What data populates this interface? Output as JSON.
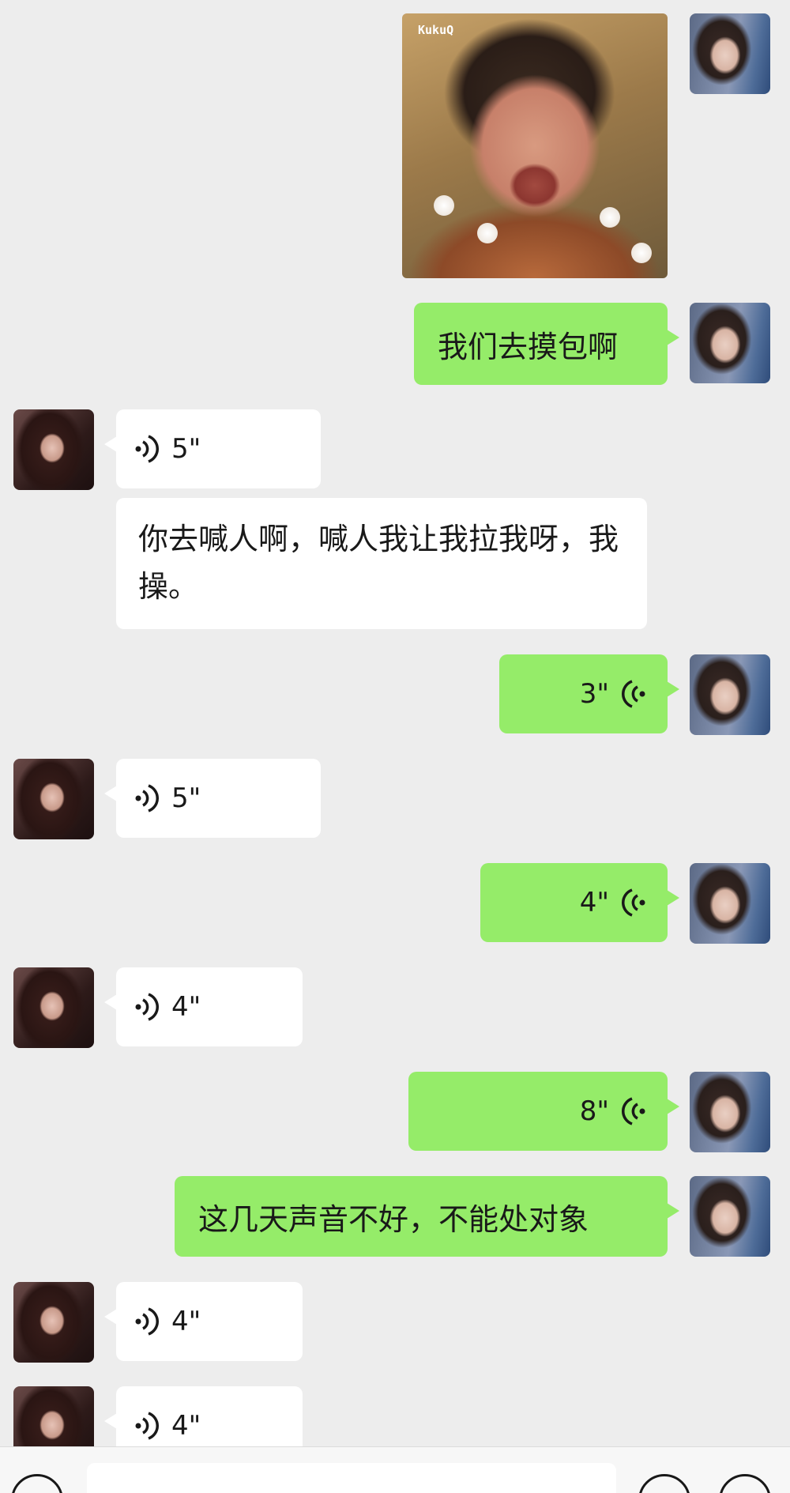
{
  "chat": {
    "image_message": {
      "watermark": "KukuQ"
    },
    "messages": [
      {
        "side": "me",
        "type": "text",
        "text": "我们去摸包啊"
      },
      {
        "side": "other",
        "type": "voice",
        "duration": "5\""
      },
      {
        "side": "other",
        "type": "text",
        "text": "你去喊人啊，喊人我让我拉我呀，我操。"
      },
      {
        "side": "me",
        "type": "voice",
        "duration": "3\""
      },
      {
        "side": "other",
        "type": "voice",
        "duration": "5\""
      },
      {
        "side": "me",
        "type": "voice",
        "duration": "4\""
      },
      {
        "side": "other",
        "type": "voice",
        "duration": "4\""
      },
      {
        "side": "me",
        "type": "voice",
        "duration": "8\""
      },
      {
        "side": "me",
        "type": "text",
        "text": "这几天声音不好，不能处对象"
      },
      {
        "side": "other",
        "type": "voice",
        "duration": "4\""
      },
      {
        "side": "other",
        "type": "voice",
        "duration": "4\""
      }
    ]
  },
  "colors": {
    "background": "#ededed",
    "my_bubble": "#95ec69",
    "their_bubble": "#ffffff"
  },
  "icons": {
    "voice_in": "voice-wave-icon",
    "voice_out": "voice-wave-icon",
    "bottom_left": "voice-mode-icon",
    "bottom_right_1": "emoji-icon",
    "bottom_right_2": "plus-icon"
  }
}
